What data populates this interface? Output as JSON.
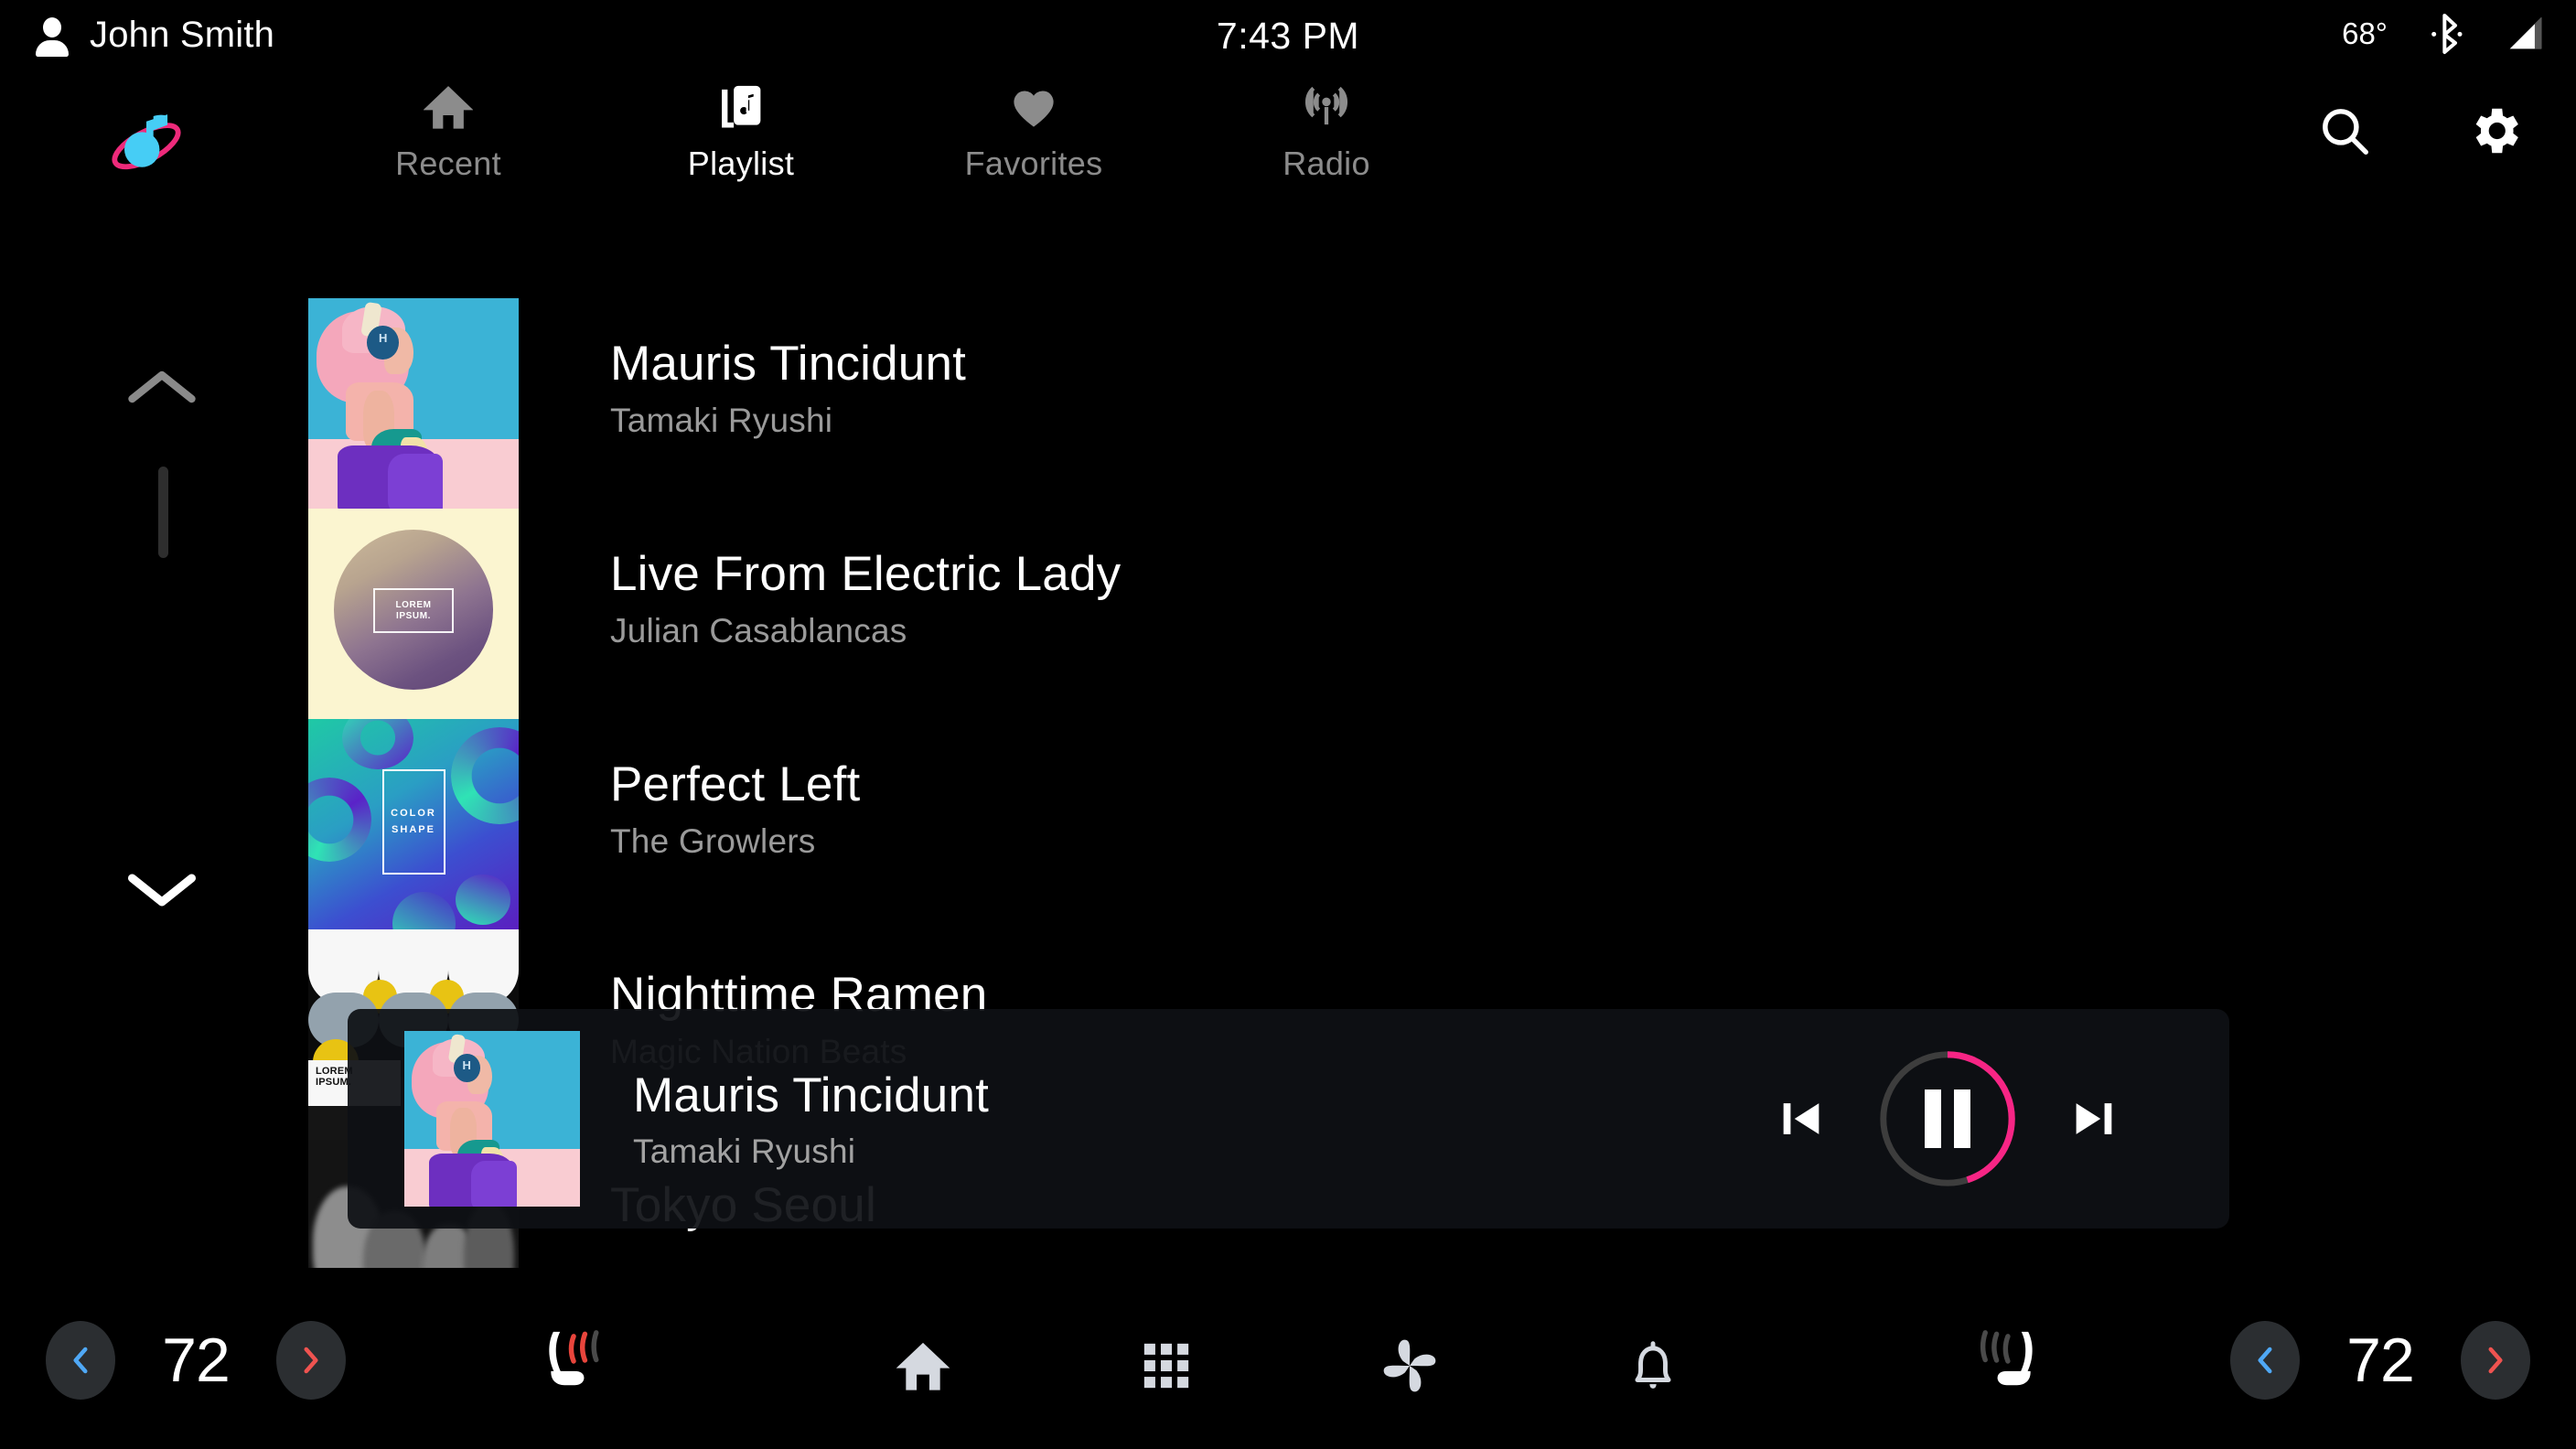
{
  "status_bar": {
    "user_name": "John Smith",
    "user_icon": "person-icon",
    "time": "7:43 PM",
    "temperature": "68°",
    "bluetooth_icon": "bluetooth-icon",
    "signal_icon": "signal-bars-icon"
  },
  "app_bar": {
    "logo_icon": "music-note-orbit-logo",
    "tabs": [
      {
        "label": "Recent",
        "icon": "home-icon",
        "active": false
      },
      {
        "label": "Playlist",
        "icon": "playlist-icon",
        "active": true
      },
      {
        "label": "Favorites",
        "icon": "heart-icon",
        "active": false
      },
      {
        "label": "Radio",
        "icon": "radio-icon",
        "active": false
      }
    ],
    "actions": [
      {
        "name": "search-button",
        "icon": "search-icon"
      },
      {
        "name": "settings-button",
        "icon": "gear-icon"
      }
    ]
  },
  "scroll": {
    "up_icon": "chevron-up-icon",
    "down_icon": "chevron-down-icon",
    "up_enabled": false,
    "down_enabled": true
  },
  "track_list": [
    {
      "title": "Mauris Tincidunt",
      "artist": "Tamaki Ryushi",
      "art": "pink-hair-photo"
    },
    {
      "title": "Live From Electric Lady",
      "artist": "Julian Casablancas",
      "art": "lorem-ipsum-sphere"
    },
    {
      "title": "Perfect Left",
      "artist": "The Growlers",
      "art": "color-shape"
    },
    {
      "title": "Nighttime Ramen",
      "artist": "Magic Nation Beats",
      "art": "geometric-circles"
    },
    {
      "title": "Tokyo Seoul",
      "artist": "",
      "art": "grayscale-crowd"
    }
  ],
  "now_playing": {
    "title": "Mauris Tincidunt",
    "artist": "Tamaki Ryushi",
    "art": "pink-hair-photo",
    "progress_percent": 45,
    "state": "playing",
    "prev_icon": "skip-previous-icon",
    "play_pause_icon": "pause-icon",
    "next_icon": "skip-next-icon",
    "progress_color": "#f72585",
    "track_color": "#3d3d3d"
  },
  "dock": {
    "left_climate": {
      "decrease_icon": "chevron-left-icon",
      "temperature": "72",
      "increase_icon": "chevron-right-icon"
    },
    "right_climate": {
      "decrease_icon": "chevron-left-icon",
      "temperature": "72",
      "increase_icon": "chevron-right-icon"
    },
    "left_seat_icon": "heated-seat-icon-active",
    "right_seat_icon": "heated-seat-icon-inactive",
    "center_buttons": [
      {
        "name": "dock-home",
        "icon": "home-icon"
      },
      {
        "name": "dock-apps",
        "icon": "apps-grid-icon"
      },
      {
        "name": "dock-climate",
        "icon": "fan-icon"
      },
      {
        "name": "dock-alerts",
        "icon": "bell-icon"
      }
    ]
  },
  "art_labels": {
    "sphere_line1": "LOREM",
    "sphere_line2": "IPSUM.",
    "shape_line1": "COLOR",
    "shape_line2": "SHAPE",
    "geo_line1": "LOREM",
    "geo_line2": "IPSUM."
  },
  "colors": {
    "background": "#000000",
    "accent_pink": "#f72585",
    "cool_blue": "#4fa8f5",
    "warm_red": "#ef5350",
    "inactive_gray": "#8c8c8c",
    "overlay_bg": "#0e1014"
  }
}
